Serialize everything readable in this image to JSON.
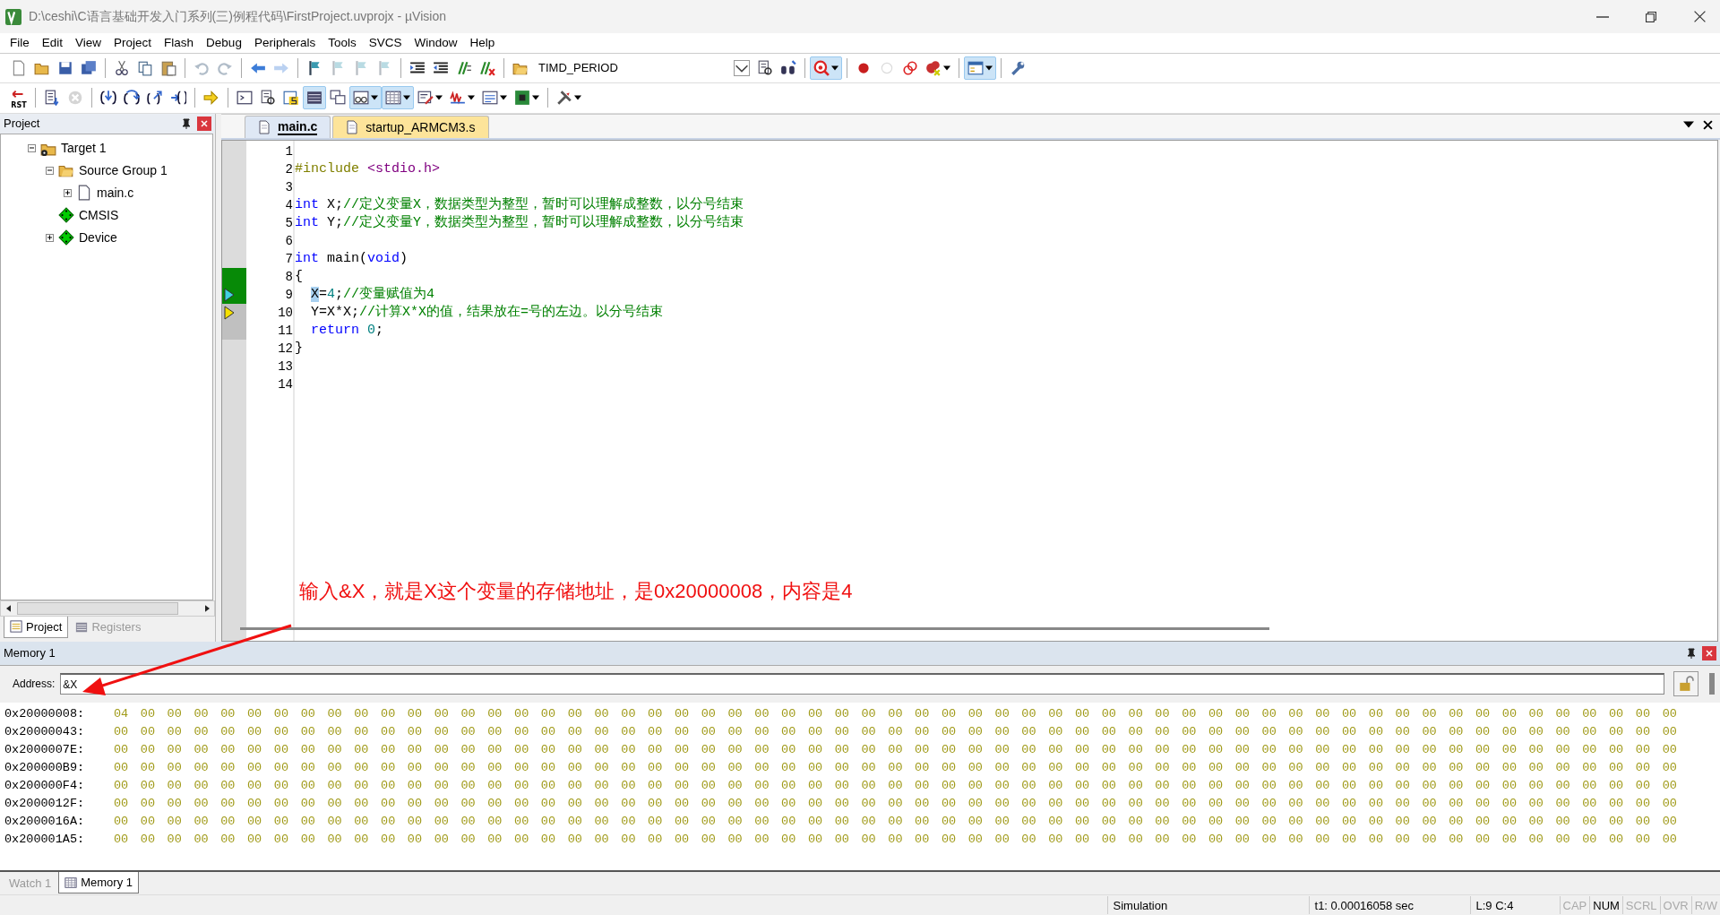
{
  "window": {
    "title": "D:\\ceshi\\C语言基础开发入门系列(三)例程代码\\FirstProject.uvprojx - µVision"
  },
  "menu": [
    "File",
    "Edit",
    "View",
    "Project",
    "Flash",
    "Debug",
    "Peripherals",
    "Tools",
    "SVCS",
    "Window",
    "Help"
  ],
  "toolbar_1": [
    {
      "kind": "new",
      "pressed": false,
      "disabled": false
    },
    {
      "kind": "open",
      "pressed": false,
      "disabled": false
    },
    {
      "kind": "save",
      "pressed": false,
      "disabled": false
    },
    {
      "kind": "saveall",
      "pressed": false,
      "disabled": false
    },
    {
      "kind": "sep"
    },
    {
      "kind": "cut",
      "pressed": false,
      "disabled": false
    },
    {
      "kind": "copy",
      "pressed": false,
      "disabled": false
    },
    {
      "kind": "paste",
      "pressed": false,
      "disabled": false
    },
    {
      "kind": "sep"
    },
    {
      "kind": "undo",
      "pressed": false,
      "disabled": true
    },
    {
      "kind": "redo",
      "pressed": false,
      "disabled": true
    },
    {
      "kind": "sep"
    },
    {
      "kind": "back",
      "pressed": false,
      "disabled": false
    },
    {
      "kind": "forward",
      "pressed": false,
      "disabled": true
    },
    {
      "kind": "sep"
    },
    {
      "kind": "flag",
      "pressed": false,
      "disabled": false
    },
    {
      "kind": "flag",
      "pressed": false,
      "disabled": true
    },
    {
      "kind": "flag",
      "pressed": false,
      "disabled": true
    },
    {
      "kind": "flag",
      "pressed": false,
      "disabled": true
    },
    {
      "kind": "sep"
    },
    {
      "kind": "indent",
      "pressed": false,
      "disabled": false
    },
    {
      "kind": "unindent",
      "pressed": false,
      "disabled": false
    },
    {
      "kind": "comment",
      "pressed": false,
      "disabled": false
    },
    {
      "kind": "uncomment",
      "pressed": false,
      "disabled": false
    },
    {
      "kind": "sep"
    },
    {
      "kind": "folder",
      "pressed": false,
      "disabled": false
    },
    {
      "kind": "combo",
      "value": "TIMD_PERIOD"
    },
    {
      "kind": "finddoc",
      "pressed": false,
      "disabled": false
    },
    {
      "kind": "binoculars",
      "pressed": false,
      "disabled": false
    },
    {
      "kind": "sep"
    },
    {
      "kind": "debug",
      "pressed": true,
      "disabled": false,
      "dropdown": true
    },
    {
      "kind": "sep"
    },
    {
      "kind": "dot",
      "pressed": false,
      "disabled": false
    },
    {
      "kind": "ring",
      "pressed": false,
      "disabled": true
    },
    {
      "kind": "rings",
      "pressed": false,
      "disabled": false
    },
    {
      "kind": "dotx",
      "pressed": false,
      "disabled": false,
      "dropdown": true
    },
    {
      "kind": "sep"
    },
    {
      "kind": "window",
      "pressed": true,
      "disabled": false,
      "dropdown": true
    },
    {
      "kind": "sep"
    },
    {
      "kind": "wrench",
      "pressed": false,
      "disabled": false
    }
  ],
  "toolbar_2": [
    {
      "kind": "reset",
      "label": "RST",
      "pressed": false,
      "disabled": false
    },
    {
      "kind": "sep"
    },
    {
      "kind": "run",
      "pressed": false,
      "disabled": false
    },
    {
      "kind": "stop",
      "pressed": false,
      "disabled": true
    },
    {
      "kind": "sep"
    },
    {
      "kind": "stepin",
      "pressed": false,
      "disabled": false
    },
    {
      "kind": "stepover",
      "pressed": false,
      "disabled": false
    },
    {
      "kind": "stepout",
      "pressed": false,
      "disabled": false
    },
    {
      "kind": "runcursor",
      "pressed": false,
      "disabled": false
    },
    {
      "kind": "sep"
    },
    {
      "kind": "arrow",
      "pressed": false,
      "disabled": false
    },
    {
      "kind": "sep"
    },
    {
      "kind": "console",
      "pressed": false,
      "disabled": false
    },
    {
      "kind": "finddoc",
      "pressed": false,
      "disabled": false
    },
    {
      "kind": "symbols",
      "pressed": false,
      "disabled": false
    },
    {
      "kind": "lines",
      "pressed": true,
      "disabled": false
    },
    {
      "kind": "stack",
      "pressed": false,
      "disabled": false
    },
    {
      "kind": "watch",
      "pressed": true,
      "disabled": false,
      "dropdown": true
    },
    {
      "kind": "grid",
      "pressed": true,
      "disabled": false,
      "dropdown": true
    },
    {
      "kind": "serial",
      "pressed": false,
      "disabled": false,
      "dropdown": true
    },
    {
      "kind": "wave",
      "pressed": false,
      "disabled": false,
      "dropdown": true
    },
    {
      "kind": "list",
      "pressed": false,
      "disabled": false,
      "dropdown": true
    },
    {
      "kind": "chip",
      "pressed": false,
      "disabled": false,
      "dropdown": true
    },
    {
      "kind": "sep"
    },
    {
      "kind": "tools",
      "pressed": false,
      "disabled": false,
      "dropdown": true
    }
  ],
  "project_panel": {
    "title": "Project",
    "tree": [
      {
        "label": "Target 1",
        "kind": "target",
        "expanded": true,
        "children": [
          {
            "label": "Source Group 1",
            "kind": "folder",
            "expanded": true,
            "children": [
              {
                "label": "main.c",
                "kind": "file",
                "expanded": false
              }
            ]
          },
          {
            "label": "CMSIS",
            "kind": "component"
          },
          {
            "label": "Device",
            "kind": "component",
            "expanded": false
          }
        ]
      }
    ],
    "tabs": [
      {
        "label": "Project",
        "selected": true
      },
      {
        "label": "Registers",
        "selected": false
      }
    ]
  },
  "editor": {
    "tabs": [
      {
        "label": "main.c",
        "selected": true
      },
      {
        "label": "startup_ARMCM3.s",
        "selected": false
      }
    ],
    "lines": [
      {
        "number": "1"
      },
      {
        "number": "2",
        "tokens": [
          {
            "kind": "preproc",
            "text": "#include"
          },
          {
            "kind": "string",
            "text": " <stdio.h>"
          }
        ]
      },
      {
        "number": "3"
      },
      {
        "number": "4",
        "tokens": [
          {
            "kind": "keyword",
            "text": "int"
          },
          {
            "kind": "plain",
            "text": " X;"
          },
          {
            "kind": "comment",
            "text": "//定义变量X，数据类型为整型，暂时可以理解成整数，以分号结束"
          }
        ]
      },
      {
        "number": "5",
        "tokens": [
          {
            "kind": "keyword",
            "text": "int"
          },
          {
            "kind": "plain",
            "text": " Y;"
          },
          {
            "kind": "comment",
            "text": "//定义变量Y，数据类型为整型，暂时可以理解成整数，以分号结束"
          }
        ]
      },
      {
        "number": "6"
      },
      {
        "number": "7",
        "tokens": [
          {
            "kind": "keyword",
            "text": "int"
          },
          {
            "kind": "plain",
            "text": " main("
          },
          {
            "kind": "keyword",
            "text": "void"
          },
          {
            "kind": "plain",
            "text": ")"
          }
        ]
      },
      {
        "number": "8",
        "executed": true,
        "tokens": [
          {
            "kind": "plain",
            "text": "{"
          }
        ]
      },
      {
        "number": "9",
        "executed": true,
        "current_line": true,
        "indented": true,
        "tokens": [
          {
            "kind": "highlight",
            "text": "X"
          },
          {
            "kind": "plain",
            "text": "="
          },
          {
            "kind": "number",
            "text": "4"
          },
          {
            "kind": "plain",
            "text": ";"
          },
          {
            "kind": "comment",
            "text": "//变量赋值为4"
          }
        ]
      },
      {
        "number": "10",
        "executed": false,
        "cursor": true,
        "indented": true,
        "tokens": [
          {
            "kind": "plain",
            "text": "Y=X*X;"
          },
          {
            "kind": "comment",
            "text": "//计算X*X的值，结果放在=号的左边。以分号结束"
          }
        ]
      },
      {
        "number": "11",
        "executed": false,
        "indented": true,
        "tokens": [
          {
            "kind": "keyword",
            "text": "return"
          },
          {
            "kind": "number",
            "text": " 0"
          },
          {
            "kind": "plain",
            "text": ";"
          }
        ]
      },
      {
        "number": "12",
        "tokens": [
          {
            "kind": "plain",
            "text": "}"
          }
        ]
      },
      {
        "number": "13"
      },
      {
        "number": "14"
      }
    ]
  },
  "annotation": {
    "text": "输入&X，就是X这个变量的存储地址，是0x20000008，内容是4"
  },
  "memory_panel": {
    "title": "Memory 1",
    "address_label": "Address:",
    "address_value": "&X",
    "rows": [
      {
        "address": "0x20000008:",
        "bytes": "04 00 00 00 00 00 00 00 00 00 00 00 00 00 00 00 00 00 00 00 00 00 00 00 00 00 00 00 00 00 00 00 00 00 00 00 00 00 00 00 00 00 00 00 00 00 00 00 00 00 00 00 00 00 00 00 00 00 00"
      },
      {
        "address": "0x20000043:",
        "bytes": "00 00 00 00 00 00 00 00 00 00 00 00 00 00 00 00 00 00 00 00 00 00 00 00 00 00 00 00 00 00 00 00 00 00 00 00 00 00 00 00 00 00 00 00 00 00 00 00 00 00 00 00 00 00 00 00 00 00 00"
      },
      {
        "address": "0x2000007E:",
        "bytes": "00 00 00 00 00 00 00 00 00 00 00 00 00 00 00 00 00 00 00 00 00 00 00 00 00 00 00 00 00 00 00 00 00 00 00 00 00 00 00 00 00 00 00 00 00 00 00 00 00 00 00 00 00 00 00 00 00 00 00"
      },
      {
        "address": "0x200000B9:",
        "bytes": "00 00 00 00 00 00 00 00 00 00 00 00 00 00 00 00 00 00 00 00 00 00 00 00 00 00 00 00 00 00 00 00 00 00 00 00 00 00 00 00 00 00 00 00 00 00 00 00 00 00 00 00 00 00 00 00 00 00 00"
      },
      {
        "address": "0x200000F4:",
        "bytes": "00 00 00 00 00 00 00 00 00 00 00 00 00 00 00 00 00 00 00 00 00 00 00 00 00 00 00 00 00 00 00 00 00 00 00 00 00 00 00 00 00 00 00 00 00 00 00 00 00 00 00 00 00 00 00 00 00 00 00"
      },
      {
        "address": "0x2000012F:",
        "bytes": "00 00 00 00 00 00 00 00 00 00 00 00 00 00 00 00 00 00 00 00 00 00 00 00 00 00 00 00 00 00 00 00 00 00 00 00 00 00 00 00 00 00 00 00 00 00 00 00 00 00 00 00 00 00 00 00 00 00 00"
      },
      {
        "address": "0x2000016A:",
        "bytes": "00 00 00 00 00 00 00 00 00 00 00 00 00 00 00 00 00 00 00 00 00 00 00 00 00 00 00 00 00 00 00 00 00 00 00 00 00 00 00 00 00 00 00 00 00 00 00 00 00 00 00 00 00 00 00 00 00 00 00"
      },
      {
        "address": "0x200001A5:",
        "bytes": "00 00 00 00 00 00 00 00 00 00 00 00 00 00 00 00 00 00 00 00 00 00 00 00 00 00 00 00 00 00 00 00 00 00 00 00 00 00 00 00 00 00 00 00 00 00 00 00 00 00 00 00 00 00 00 00 00 00 00"
      }
    ],
    "tabs": [
      {
        "label": "Watch 1",
        "selected": false
      },
      {
        "label": "Memory 1",
        "selected": true
      }
    ]
  },
  "status_bar": {
    "mode": "Simulation",
    "time": "t1: 0.00016058 sec",
    "position": "L:9 C:4",
    "indicators": [
      {
        "label": "CAP",
        "on": false
      },
      {
        "label": "NUM",
        "on": true
      },
      {
        "label": "SCRL",
        "on": false
      },
      {
        "label": "OVR",
        "on": false
      },
      {
        "label": "R/W",
        "on": false
      }
    ]
  }
}
